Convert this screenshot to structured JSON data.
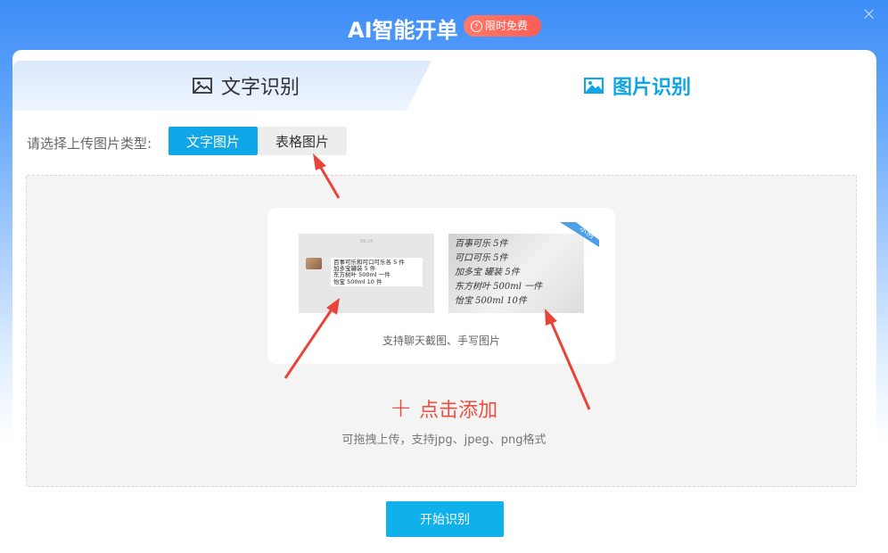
{
  "header": {
    "title": "AI智能开单",
    "badge": "限时免费",
    "close": "×"
  },
  "tabs": [
    {
      "label": "文字识别",
      "active": false,
      "icon": "image-icon"
    },
    {
      "label": "图片识别",
      "active": true,
      "icon": "image-icon"
    }
  ],
  "type_select": {
    "label": "请选择上传图片类型:",
    "options": [
      "文字图片",
      "表格图片"
    ],
    "selected": "文字图片"
  },
  "example": {
    "chat_time": "09:24",
    "chat_lines": [
      "百事可乐和可口可乐各 5 件",
      "加多宝罐装 5 件",
      "东方树叶 500ml 一件",
      "怡宝 500ml 10 件"
    ],
    "hand_lines": [
      "百事可乐 5件",
      "可口可乐 5件",
      "加多宝 罐装 5件",
      "东方树叶 500ml 一件",
      "怡宝 500ml 10件"
    ],
    "ribbon": "示例",
    "caption": "支持聊天截图、手写图片"
  },
  "upload": {
    "add_label": "点击添加",
    "hint": "可拖拽上传，支持jpg、jpeg、png格式"
  },
  "start_button": "开始识别",
  "colors": {
    "accent": "#10a7e8",
    "add_red": "#f04e40",
    "badge": "#ff6b5f",
    "arrow": "#e8443a"
  }
}
